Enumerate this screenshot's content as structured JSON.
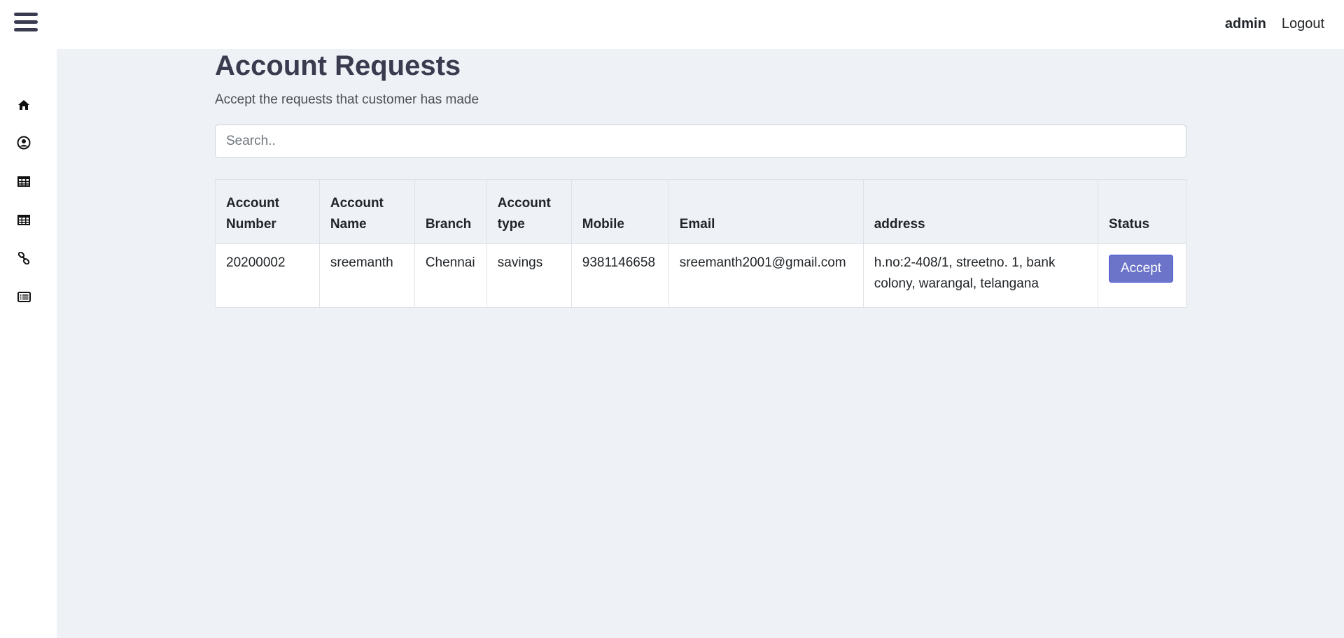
{
  "header": {
    "user_name": "admin",
    "logout_label": "Logout"
  },
  "sidebar": {
    "items": [
      {
        "icon": "home-icon"
      },
      {
        "icon": "user-circle-icon"
      },
      {
        "icon": "table-icon"
      },
      {
        "icon": "table-icon"
      },
      {
        "icon": "link-icon"
      },
      {
        "icon": "list-alt-icon"
      }
    ]
  },
  "main": {
    "title": "Account Requests",
    "subtitle": "Accept the requests that customer has made",
    "search_placeholder": "Search..",
    "table": {
      "headers": [
        "Account Number",
        "Account Name",
        "Branch",
        "Account type",
        "Mobile",
        "Email",
        "address",
        "Status"
      ],
      "rows": [
        {
          "account_number": "20200002",
          "account_name": "sreemanth",
          "branch": "Chennai",
          "account_type": "savings",
          "mobile": "9381146658",
          "email": "sreemanth2001@gmail.com",
          "address": "h.no:2-408/1, streetno. 1, bank colony, warangal, telangana",
          "action_label": "Accept"
        }
      ]
    }
  },
  "colors": {
    "accent": "#6b74c8",
    "main_bg": "#eef1f6",
    "title": "#3a3b4f"
  }
}
